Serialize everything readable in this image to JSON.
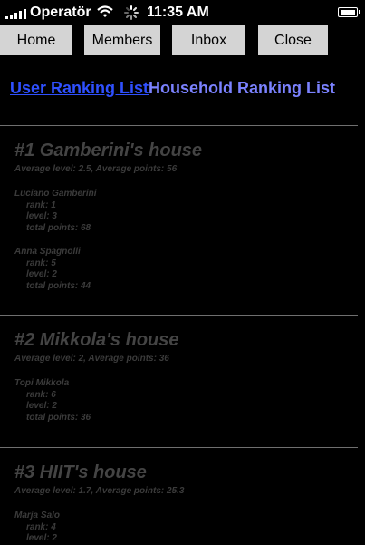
{
  "status_bar": {
    "carrier": "Operatör",
    "time": "11:35 AM"
  },
  "nav": {
    "home": "Home",
    "members": "Members",
    "inbox": "Inbox",
    "close": "Close"
  },
  "links": {
    "user_ranking": "User Ranking List",
    "household_ranking": "Household Ranking List"
  },
  "houses": [
    {
      "title": "#1 Gamberini's house",
      "summary": "Average level: 2.5, Average points: 56",
      "members": [
        {
          "name": "Luciano Gamberini",
          "rank": "rank: 1",
          "level": "level: 3",
          "points": "total points: 68"
        },
        {
          "name": "Anna Spagnolli",
          "rank": "rank: 5",
          "level": "level: 2",
          "points": "total points: 44"
        }
      ]
    },
    {
      "title": "#2 Mikkola's house",
      "summary": "Average level: 2, Average points: 36",
      "members": [
        {
          "name": "Topi Mikkola",
          "rank": "rank: 6",
          "level": "level: 2",
          "points": "total points: 36"
        }
      ]
    },
    {
      "title": "#3 HIIT's house",
      "summary": "Average level: 1.7, Average points: 25.3",
      "members": [
        {
          "name": "Marja Salo",
          "rank": "rank: 4",
          "level": "level: 2"
        }
      ]
    }
  ]
}
